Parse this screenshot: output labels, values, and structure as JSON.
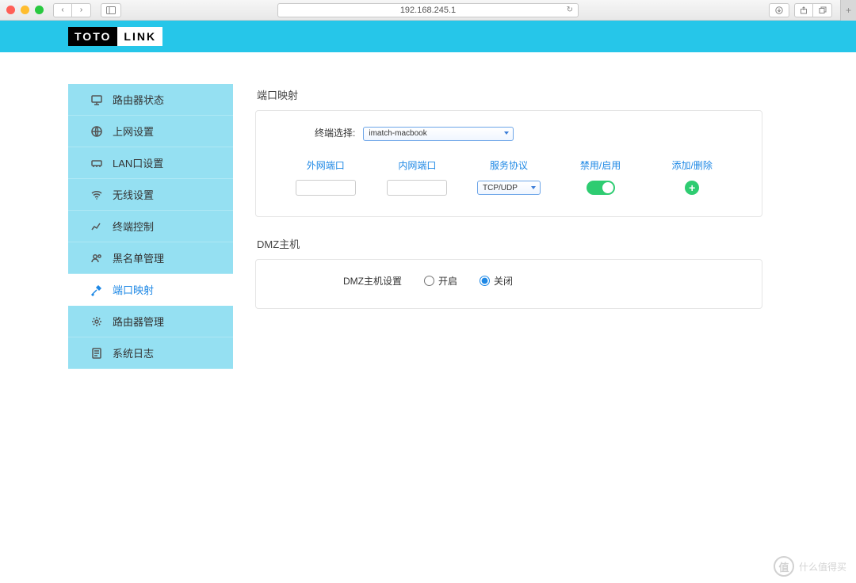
{
  "browser": {
    "url": "192.168.245.1"
  },
  "logo": {
    "left": "TOTO",
    "right": "LINK"
  },
  "sidebar": {
    "items": [
      {
        "label": "路由器状态",
        "icon": "monitor"
      },
      {
        "label": "上网设置",
        "icon": "globe"
      },
      {
        "label": "LAN口设置",
        "icon": "lan"
      },
      {
        "label": "无线设置",
        "icon": "wifi"
      },
      {
        "label": "终端控制",
        "icon": "chart"
      },
      {
        "label": "黑名单管理",
        "icon": "users"
      },
      {
        "label": "端口映射",
        "icon": "tools",
        "active": true
      },
      {
        "label": "路由器管理",
        "icon": "gear"
      },
      {
        "label": "系统日志",
        "icon": "log"
      }
    ]
  },
  "portMapping": {
    "title": "端口映射",
    "terminalLabel": "终端选择:",
    "terminalValue": "imatch-macbook",
    "headers": {
      "external": "外网端口",
      "internal": "内网端口",
      "protocol": "服务协议",
      "enable": "禁用/启用",
      "action": "添加/删除"
    },
    "protocolValue": "TCP/UDP",
    "externalPort": "",
    "internalPort": ""
  },
  "dmz": {
    "title": "DMZ主机",
    "settingLabel": "DMZ主机设置",
    "optOn": "开启",
    "optOff": "关闭",
    "value": "off"
  },
  "watermark": {
    "brand": "值",
    "text": "什么值得买"
  }
}
